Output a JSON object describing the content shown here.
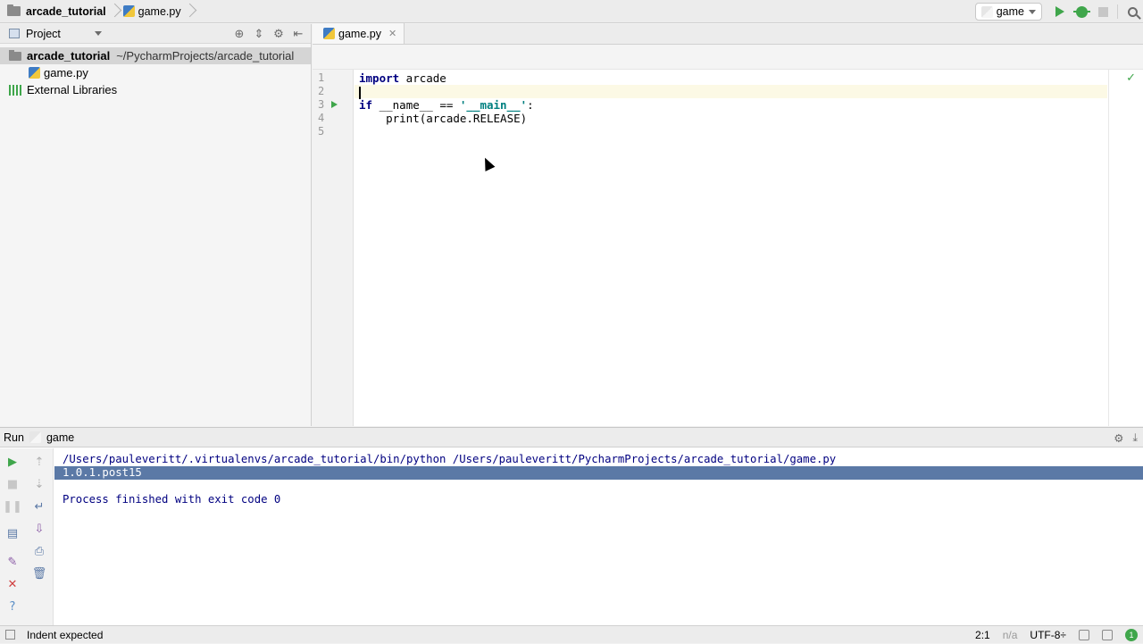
{
  "navbar": {
    "project_crumb": "arcade_tutorial",
    "file_crumb": "game.py",
    "run_config": "game"
  },
  "project_panel": {
    "title": "Project",
    "tree": {
      "root_name": "arcade_tutorial",
      "root_path": "~/PycharmProjects/arcade_tutorial",
      "file": "game.py",
      "libraries": "External Libraries"
    }
  },
  "editor": {
    "tab_label": "game.py",
    "line_numbers": [
      "1",
      "2",
      "3",
      "4",
      "5"
    ],
    "code": {
      "l1_kw": "import",
      "l1_rest": " arcade",
      "l3_kw": "if",
      "l3_mid": " __name__ == ",
      "l3_str": "'__main__'",
      "l3_end": ":",
      "l4": "    print(arcade.RELEASE)"
    },
    "check_icon": "✓"
  },
  "run_panel": {
    "label": "Run",
    "config": "game",
    "console": [
      "/Users/pauleveritt/.virtualenvs/arcade_tutorial/bin/python /Users/pauleveritt/PycharmProjects/arcade_tutorial/game.py",
      "1.0.1.post15",
      "",
      "Process finished with exit code 0"
    ]
  },
  "statusbar": {
    "message": "Indent expected",
    "position": "2:1",
    "na": "n/a",
    "encoding": "UTF-8÷",
    "badge": "1"
  },
  "colors": {
    "accent_green": "#3fa64b",
    "console_text": "#000080",
    "selection": "#5b79a6"
  }
}
